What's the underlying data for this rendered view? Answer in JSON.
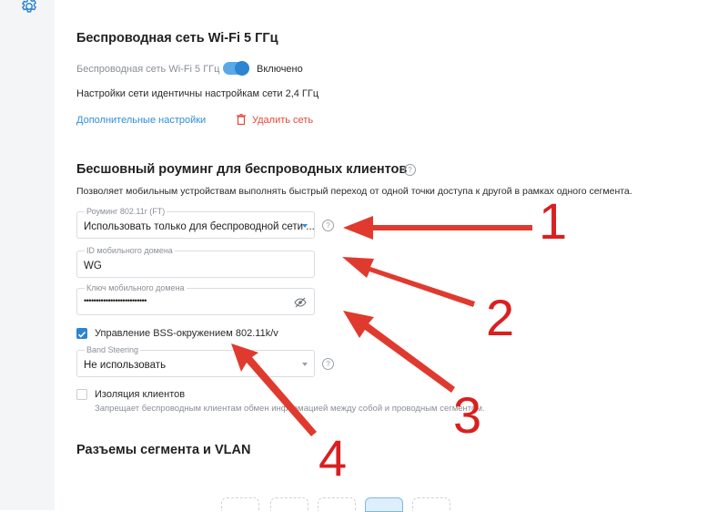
{
  "wifi5": {
    "title": "Беспроводная сеть Wi-Fi 5 ГГц",
    "toggle_label": "Беспроводная сеть Wi-Fi 5 ГГц",
    "toggle_state": "Включено",
    "identical_note": "Настройки сети идентичны настройкам сети 2,4 ГГц",
    "advanced_link": "Дополнительные настройки",
    "delete_link": "Удалить сеть"
  },
  "roaming": {
    "title": "Бесшовный роуминг для беспроводных клиентов",
    "description": "Позволяет мобильным устройствам выполнять быстрый переход от одной точки доступа к другой в рамках одного сегмента.",
    "ft_label": "Роуминг 802.11r (FT)",
    "ft_value": "Использовать только для беспроводной сети ...",
    "domain_id_label": "ID мобильного домена",
    "domain_id_value": "WG",
    "domain_key_label": "Ключ мобильного домена",
    "domain_key_value": "••••••••••••••••••••••••••",
    "bss_label": "Управление BSS-окружением 802.11k/v",
    "bss_checked": true,
    "band_label": "Band Steering",
    "band_value": "Не использовать",
    "isolation_label": "Изоляция клиентов",
    "isolation_checked": false,
    "isolation_note": "Запрещает беспроводным клиентам обмен информацией между собой и проводным сегментом."
  },
  "segments": {
    "title": "Разъемы сегмента и VLAN"
  },
  "annotations": {
    "n1": "1",
    "n2": "2",
    "n3": "3",
    "n4": "4",
    "arrow_color": "#e03a2f"
  },
  "colors": {
    "accent": "#2b85d0",
    "link": "#2f8fd6",
    "danger": "#e5483d"
  }
}
